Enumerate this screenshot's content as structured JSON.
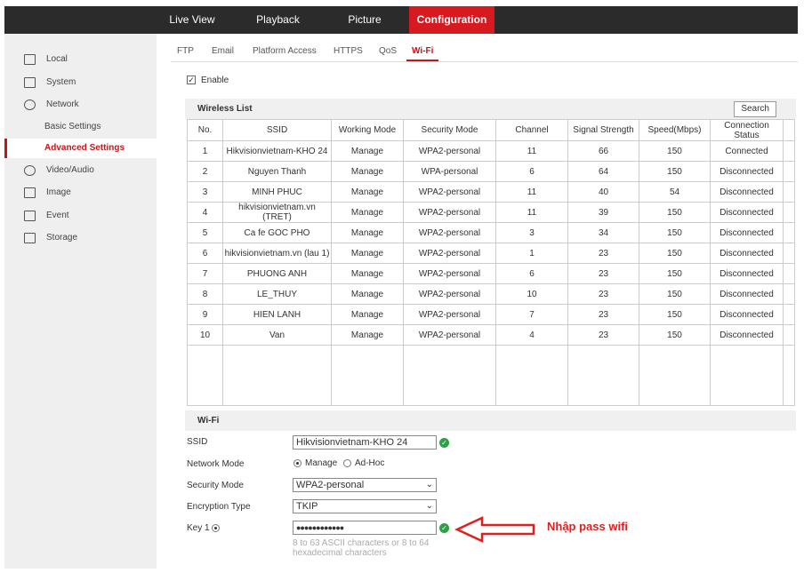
{
  "topnav": [
    "Live View",
    "Playback",
    "Picture",
    "Configuration"
  ],
  "sidebar": {
    "items": [
      "Local",
      "System",
      "Network",
      "Basic Settings",
      "Advanced Settings",
      "Video/Audio",
      "Image",
      "Event",
      "Storage"
    ]
  },
  "tabs": [
    "FTP",
    "Email",
    "Platform Access",
    "HTTPS",
    "QoS",
    "Wi-Fi"
  ],
  "enable_label": "Enable",
  "wireless_list": {
    "title": "Wireless List",
    "search_label": "Search",
    "headers": [
      "No.",
      "SSID",
      "Working Mode",
      "Security Mode",
      "Channel",
      "Signal Strength",
      "Speed(Mbps)",
      "Connection Status"
    ],
    "rows": [
      [
        "1",
        "Hikvisionvietnam-KHO 24",
        "Manage",
        "WPA2-personal",
        "11",
        "66",
        "150",
        "Connected"
      ],
      [
        "2",
        "Nguyen Thanh",
        "Manage",
        "WPA-personal",
        "6",
        "64",
        "150",
        "Disconnected"
      ],
      [
        "3",
        "MINH PHUC",
        "Manage",
        "WPA2-personal",
        "11",
        "40",
        "54",
        "Disconnected"
      ],
      [
        "4",
        "hikvisionvietnam.vn (TRET)",
        "Manage",
        "WPA2-personal",
        "11",
        "39",
        "150",
        "Disconnected"
      ],
      [
        "5",
        "Ca fe GOC PHO",
        "Manage",
        "WPA2-personal",
        "3",
        "34",
        "150",
        "Disconnected"
      ],
      [
        "6",
        "hikvisionvietnam.vn (lau 1)",
        "Manage",
        "WPA2-personal",
        "1",
        "23",
        "150",
        "Disconnected"
      ],
      [
        "7",
        "PHUONG ANH",
        "Manage",
        "WPA2-personal",
        "6",
        "23",
        "150",
        "Disconnected"
      ],
      [
        "8",
        "LE_THUY",
        "Manage",
        "WPA2-personal",
        "10",
        "23",
        "150",
        "Disconnected"
      ],
      [
        "9",
        "HIEN LANH",
        "Manage",
        "WPA2-personal",
        "7",
        "23",
        "150",
        "Disconnected"
      ],
      [
        "10",
        "Van",
        "Manage",
        "WPA2-personal",
        "4",
        "23",
        "150",
        "Disconnected"
      ]
    ]
  },
  "wifi": {
    "title": "Wi-Fi",
    "ssid_label": "SSID",
    "ssid_value": "Hikvisionvietnam-KHO 24",
    "network_mode_label": "Network Mode",
    "mode_manage": "Manage",
    "mode_adhoc": "Ad-Hoc",
    "security_mode_label": "Security Mode",
    "security_mode_value": "WPA2-personal",
    "encryption_label": "Encryption Type",
    "encryption_value": "TKIP",
    "key_label": "Key 1",
    "key_value": "●●●●●●●●●●●●",
    "hint": "8 to 63 ASCII characters or 8 to 64 hexadecimal characters"
  },
  "annotation": "Nhập pass wifi",
  "colors": {
    "accent": "#d71920",
    "annotation": "#e02020",
    "ok": "#2ea043"
  }
}
